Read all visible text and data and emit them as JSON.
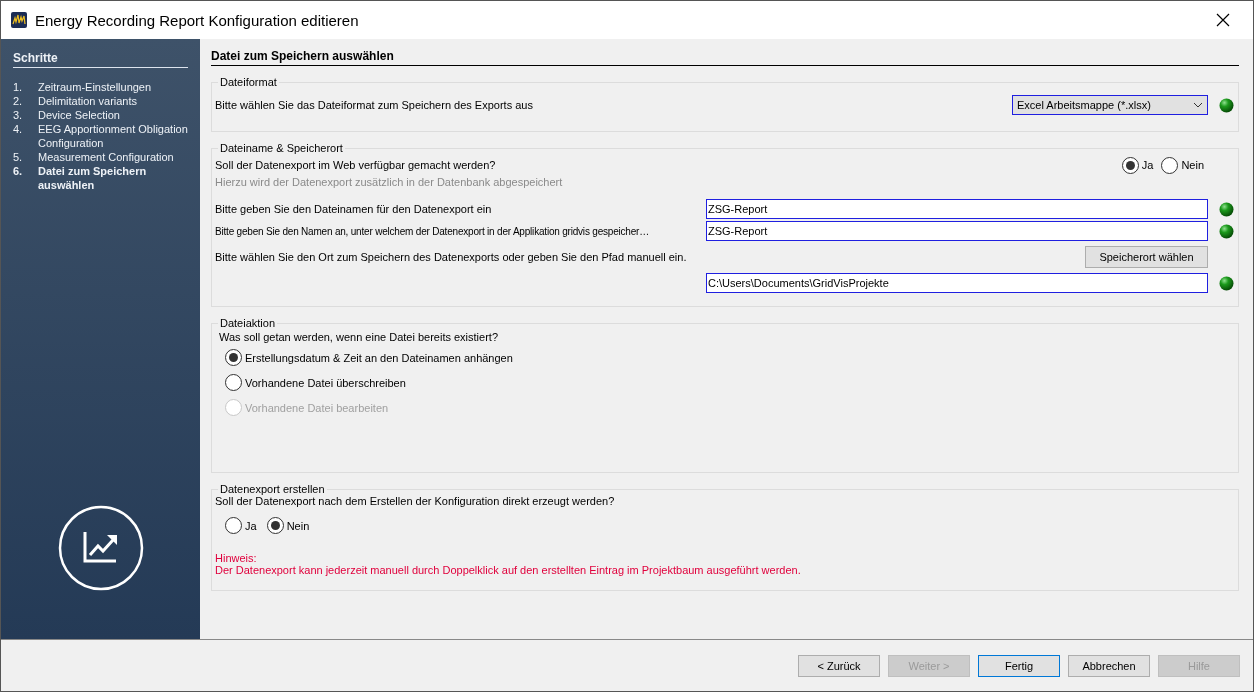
{
  "window": {
    "title": "Energy Recording Report Konfiguration editieren"
  },
  "sidebar": {
    "heading": "Schritte",
    "steps": [
      {
        "number": "1.",
        "label": "Zeitraum-Einstellungen",
        "selected": false
      },
      {
        "number": "2.",
        "label": "Delimitation variants",
        "selected": false
      },
      {
        "number": "3.",
        "label": "Device Selection",
        "selected": false
      },
      {
        "number": "4.",
        "label": "EEG Apportionment Obligation Configuration",
        "selected": false
      },
      {
        "number": "5.",
        "label": "Measurement Configuration",
        "selected": false
      },
      {
        "number": "6.",
        "label": "Datei zum Speichern auswählen",
        "selected": true
      }
    ]
  },
  "page_title": "Datei zum Speichern auswählen",
  "file_format": {
    "title": "Dateiformat",
    "prompt": "Bitte wählen Sie das Dateiformat zum Speichern des Exports aus",
    "select_value": "Excel Arbeitsmappe (*.xlsx)"
  },
  "file_name": {
    "title": "Dateiname & Speicherort",
    "web_question": "Soll der Datenexport im Web verfügbar gemacht werden?",
    "web_options": [
      {
        "label": "Ja",
        "selected": true
      },
      {
        "label": "Nein",
        "selected": false
      }
    ],
    "web_hint": "Hierzu wird der Datenexport zusätzlich in der Datenbank abgespeichert",
    "name_prompt": "Bitte geben Sie den Dateinamen für den Datenexport ein",
    "name_value": "ZSG-Report",
    "app_name_prompt": "Bitte geben Sie den Namen an, unter welchem der Datenexport in der Applikation gridvis gespeicher…",
    "app_name_value": "ZSG-Report",
    "location_prompt": "Bitte wählen Sie den Ort zum Speichern des Datenexports oder geben Sie den Pfad manuell ein.",
    "location_button": "Speicherort wählen",
    "location_value": "C:\\Users\\Documents\\GridVisProjekte"
  },
  "file_action": {
    "title": "Dateiaktion",
    "question": "Was soll getan werden, wenn eine Datei bereits existiert?",
    "options": [
      {
        "label": "Erstellungsdatum & Zeit an den Dateinamen anhängen",
        "selected": true,
        "disabled": false
      },
      {
        "label": "Vorhandene Datei überschreiben",
        "selected": false,
        "disabled": false
      },
      {
        "label": "Vorhandene Datei bearbeiten",
        "selected": false,
        "disabled": true
      }
    ]
  },
  "export": {
    "title": "Datenexport erstellen",
    "question": "Soll der Datenexport nach dem Erstellen der Konfiguration direkt erzeugt werden?",
    "options": [
      {
        "label": "Ja",
        "selected": false
      },
      {
        "label": "Nein",
        "selected": true
      }
    ],
    "note_label": "Hinweis:",
    "note": "Der Datenexport kann jederzeit manuell durch Doppelklick auf den erstellten Eintrag im Projektbaum ausgeführt werden."
  },
  "buttons": [
    {
      "label": "< Zurück",
      "disabled": false,
      "default": false
    },
    {
      "label": "Weiter >",
      "disabled": true,
      "default": false
    },
    {
      "label": "Fertig",
      "disabled": false,
      "default": true
    },
    {
      "label": "Abbrechen",
      "disabled": false,
      "default": false
    },
    {
      "label": "Hilfe",
      "disabled": true,
      "default": false
    }
  ]
}
